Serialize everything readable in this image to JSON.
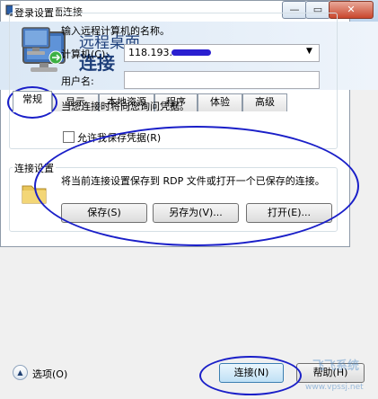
{
  "window": {
    "title": "远程桌面连接"
  },
  "banner": {
    "line1": "远程桌面",
    "line2": "连接"
  },
  "tabs": [
    {
      "label": "常规"
    },
    {
      "label": "显示"
    },
    {
      "label": "本地资源"
    },
    {
      "label": "程序"
    },
    {
      "label": "体验"
    },
    {
      "label": "高级"
    }
  ],
  "login": {
    "group_label": "登录设置",
    "instruction": "输入远程计算机的名称。",
    "computer_label": "计算机(C):",
    "computer_value": "118.193.",
    "user_label": "用户名:",
    "user_value": "",
    "credentials_note": "当您连接时将向您询问凭据。",
    "allow_save_label": "允许我保存凭据(R)",
    "allow_save_checked": false
  },
  "connection": {
    "group_label": "连接设置",
    "description": "将当前连接设置保存到 RDP 文件或打开一个已保存的连接。",
    "save_label": "保存(S)",
    "save_as_label": "另存为(V)...",
    "open_label": "打开(E)..."
  },
  "footer": {
    "options_label": "选项(O)",
    "connect_label": "连接(N)",
    "help_label": "帮助(H)"
  },
  "watermark": {
    "text": "飞飞系统",
    "url": "www.vpssj.net"
  },
  "colors": {
    "annotation": "#1a1fc8",
    "title_blue": "#1e3f7a"
  }
}
